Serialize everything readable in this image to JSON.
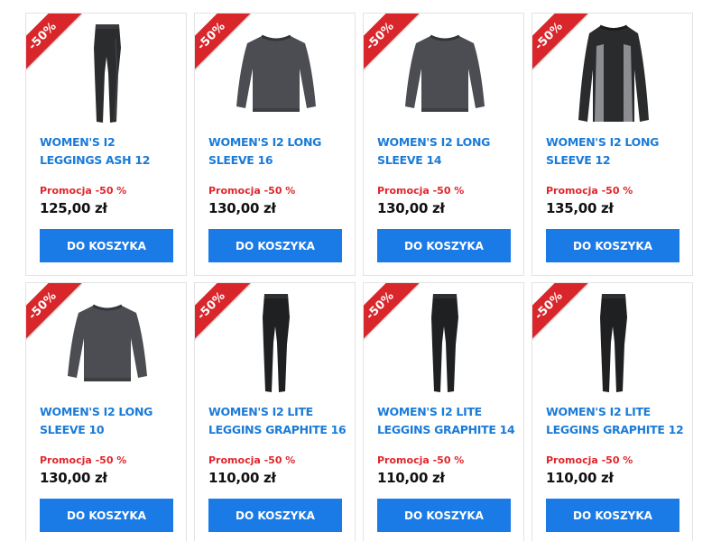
{
  "products": [
    {
      "name": "WOMEN'S I2 LEGGINGS ASH 12",
      "promo": "Promocja -50 %",
      "price": "125,00 zł",
      "badge": "-50%",
      "cta": "DO KOSZYKA",
      "image_icon": "leggings-ash"
    },
    {
      "name": "WOMEN'S I2 LONG SLEEVE 16",
      "promo": "Promocja -50 %",
      "price": "130,00 zł",
      "badge": "-50%",
      "cta": "DO KOSZYKA",
      "image_icon": "long-sleeve-grey"
    },
    {
      "name": "WOMEN'S I2 LONG SLEEVE 14",
      "promo": "Promocja -50 %",
      "price": "130,00 zł",
      "badge": "-50%",
      "cta": "DO KOSZYKA",
      "image_icon": "long-sleeve-grey"
    },
    {
      "name": "WOMEN'S I2 LONG SLEEVE 12",
      "promo": "Promocja -50 %",
      "price": "135,00 zł",
      "badge": "-50%",
      "cta": "DO KOSZYKA",
      "image_icon": "long-sleeve-two-tone"
    },
    {
      "name": "WOMEN'S I2 LONG SLEEVE 10",
      "promo": "Promocja -50 %",
      "price": "130,00 zł",
      "badge": "-50%",
      "cta": "DO KOSZYKA",
      "image_icon": "long-sleeve-grey"
    },
    {
      "name": "WOMEN'S I2 LITE LEGGINS GRAPHITE 16",
      "promo": "Promocja -50 %",
      "price": "110,00 zł",
      "badge": "-50%",
      "cta": "DO KOSZYKA",
      "image_icon": "leggings-graphite"
    },
    {
      "name": "WOMEN'S I2 LITE LEGGINS GRAPHITE 14",
      "promo": "Promocja -50 %",
      "price": "110,00 zł",
      "badge": "-50%",
      "cta": "DO KOSZYKA",
      "image_icon": "leggings-graphite"
    },
    {
      "name": "WOMEN'S I2 LITE LEGGINS GRAPHITE 12",
      "promo": "Promocja -50 %",
      "price": "110,00 zł",
      "badge": "-50%",
      "cta": "DO KOSZYKA",
      "image_icon": "leggings-graphite"
    }
  ],
  "colors": {
    "accent": "#1a7be6",
    "title": "#1a7bd8",
    "promo": "#e0262c",
    "badge": "#d8262b"
  }
}
